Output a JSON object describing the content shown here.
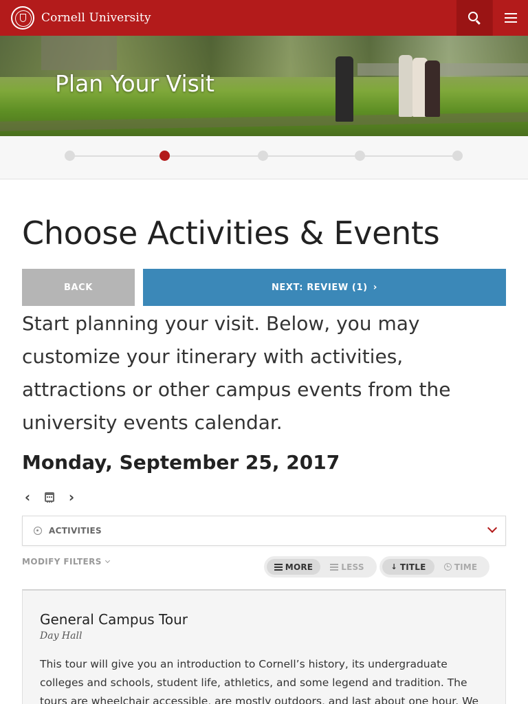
{
  "header": {
    "brand": "Cornell University",
    "logo_icon": "cornell-seal-icon",
    "search_icon": "search-icon",
    "menu_icon": "hamburger-menu-icon",
    "brand_color": "#b31b1b"
  },
  "hero": {
    "title": "Plan Your Visit"
  },
  "stepper": {
    "steps": 5,
    "active_index": 1
  },
  "main": {
    "title": "Choose Activities & Events",
    "back_label": "BACK",
    "next_label": "NEXT: REVIEW (1)",
    "next_color": "#3b88b8",
    "intro": "Start planning your visit. Below, you may customize your itinerary with activities, attractions or other campus events from the university events calendar."
  },
  "schedule": {
    "date": "Monday, September 25, 2017",
    "filter_label": "ACTIVITIES",
    "modify_filters": "MODIFY FILTERS",
    "view_more": "MORE",
    "view_less": "LESS",
    "sort_title": "TITLE",
    "sort_time": "TIME"
  },
  "events": [
    {
      "title": "General Campus Tour",
      "location": "Day Hall",
      "description": "This tour will give you an introduction to Cornell’s history, its undergraduate colleges and schools, student life, athletics, and some legend and tradition. The tours are wheelchair accessible, are mostly outdoors, and last about one hour. We conduct tours rain or shine."
    }
  ]
}
